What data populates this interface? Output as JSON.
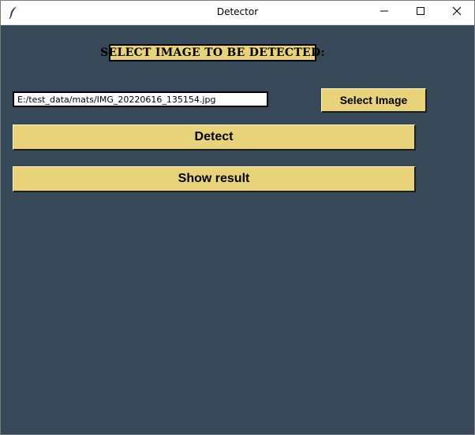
{
  "window": {
    "title": "Detector",
    "icons": {
      "app": "feather-icon",
      "minimize": "minimize-icon",
      "maximize": "maximize-icon",
      "close": "close-icon"
    }
  },
  "main": {
    "header_label": "SELECT IMAGE TO BE DETECTED:",
    "path_input": {
      "value": "E:/test_data/mats/IMG_20220616_135154.jpg"
    },
    "select_button": "Select Image",
    "detect_button": "Detect",
    "show_result_button": "Show result"
  },
  "colors": {
    "background": "#374858",
    "button": "#e8d27a",
    "titlebar": "#ffffff"
  }
}
